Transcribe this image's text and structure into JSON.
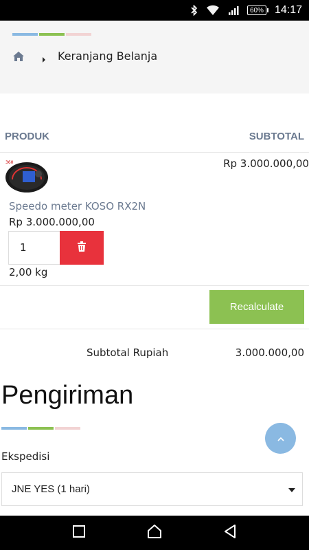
{
  "status_bar": {
    "battery": "60%",
    "time": "14:17"
  },
  "breadcrumb": {
    "home_icon": "home-icon",
    "current": "Keranjang Belanja"
  },
  "cart": {
    "headers": {
      "product": "PRODUK",
      "subtotal": "SUBTOTAL"
    },
    "items": [
      {
        "name": "Speedo meter KOSO RX2N",
        "price": "Rp 3.000.000,00",
        "subtotal": "Rp 3.000.000,00",
        "quantity": "1",
        "weight": "2,00 kg",
        "image_icon": "speedometer-image"
      }
    ],
    "recalculate_label": "Recalculate",
    "subtotal_label": "Subtotal Rupiah",
    "subtotal_value": "3.000.000,00"
  },
  "shipping": {
    "title": "Pengiriman",
    "courier_label": "Ekspedisi",
    "courier_selected": "JNE YES (1 hari)"
  },
  "colors": {
    "accent_blue": "#8ab9e2",
    "accent_green": "#8cc152",
    "accent_pink": "#f2d3d3",
    "danger": "#e8323c"
  }
}
